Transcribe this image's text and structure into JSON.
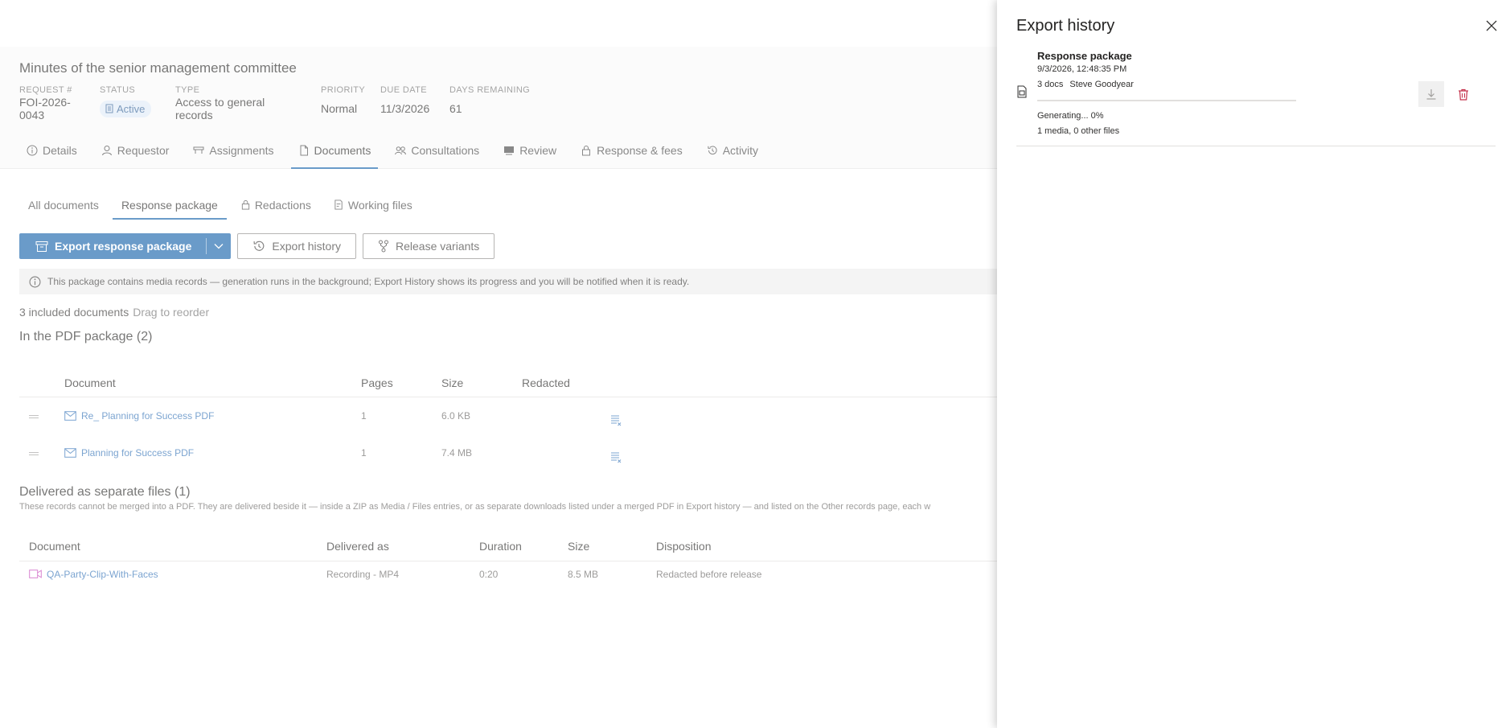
{
  "record": {
    "title": "Minutes of the senior management committee",
    "fields": [
      {
        "label": "REQUEST #",
        "value": "FOI-2026-0043"
      },
      {
        "label": "STATUS",
        "value": "Active"
      },
      {
        "label": "TYPE",
        "value": "Access to general records"
      },
      {
        "label": "PRIORITY",
        "value": "Normal"
      },
      {
        "label": "DUE DATE",
        "value": "11/3/2026"
      },
      {
        "label": "DAYS REMAINING",
        "value": "61"
      }
    ]
  },
  "tabs": [
    {
      "label": "Details",
      "icon": "info-icon"
    },
    {
      "label": "Requestor",
      "icon": "person-icon"
    },
    {
      "label": "Assignments",
      "icon": "assignments-icon"
    },
    {
      "label": "Documents",
      "icon": "document-icon",
      "active": true
    },
    {
      "label": "Consultations",
      "icon": "people-icon"
    },
    {
      "label": "Review",
      "icon": "review-icon"
    },
    {
      "label": "Response & fees",
      "icon": "lock-icon"
    },
    {
      "label": "Activity",
      "icon": "history-icon"
    }
  ],
  "subtabs": [
    {
      "label": "All documents"
    },
    {
      "label": "Response package",
      "active": true
    },
    {
      "label": "Redactions",
      "icon": "lock-icon"
    },
    {
      "label": "Working files",
      "icon": "edit-document-icon"
    }
  ],
  "toolbar": {
    "export_label": "Export response package",
    "history_label": "Export history",
    "variants_label": "Release variants"
  },
  "info_message": "This package contains media records — generation runs in the background; Export History shows its progress and you will be notified when it is ready.",
  "summary": {
    "count_text": "3 included documents",
    "hint": "Drag to reorder"
  },
  "pdf_section": {
    "title": "In the PDF package (2)",
    "columns": [
      "Document",
      "Pages",
      "Size",
      "Redacted"
    ],
    "rows": [
      {
        "name": "Re_ Planning for Success PDF",
        "pages": "1",
        "size": "6.0 KB"
      },
      {
        "name": "Planning for Success PDF",
        "pages": "1",
        "size": "7.4 MB"
      }
    ]
  },
  "separate_section": {
    "title": "Delivered as separate files (1)",
    "description": "These records cannot be merged into a PDF. They are delivered beside it — inside a ZIP as Media / Files entries, or as separate downloads listed under a merged PDF in Export history — and listed on the Other records page, each w",
    "columns": [
      "Document",
      "Delivered as",
      "Duration",
      "Size",
      "Disposition"
    ],
    "rows": [
      {
        "name": "QA-Party-Clip-With-Faces",
        "delivered_as": "Recording - MP4",
        "duration": "0:20",
        "size": "8.5 MB",
        "disposition": "Redacted before release"
      }
    ]
  },
  "export_panel": {
    "title": "Export history",
    "items": [
      {
        "name": "Response package",
        "date": "9/3/2026, 12:48:35 PM",
        "docs": "3 docs",
        "user": "Steve Goodyear",
        "progress": 0,
        "status": "Generating... 0%",
        "files": "1 media, 0 other files"
      }
    ]
  },
  "colors": {
    "accent": "#0f5ea8",
    "link": "#2b6cb4",
    "delete": "#c4314b",
    "media": "#c239b3"
  }
}
